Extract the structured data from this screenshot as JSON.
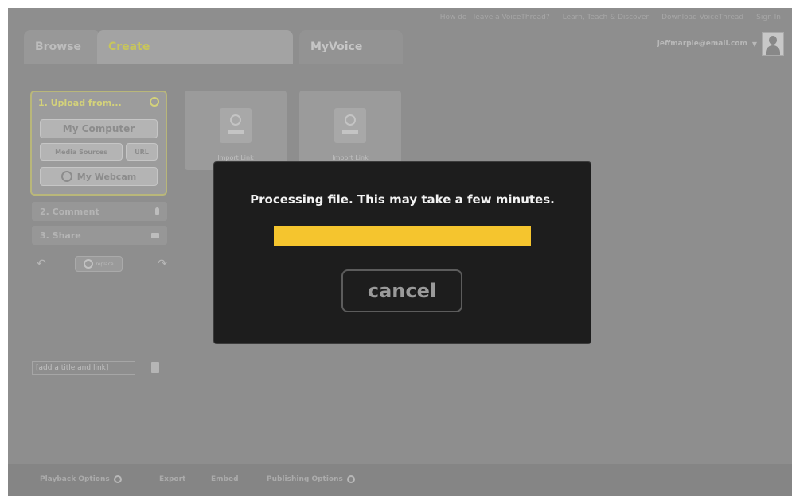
{
  "top_links": [
    "How do I leave a VoiceThread?",
    "Learn, Teach & Discover",
    "Download VoiceThread",
    "Sign In"
  ],
  "tabs": {
    "browse": "Browse",
    "create": "Create",
    "myvoice": "MyVoice"
  },
  "account": {
    "email": "jeffmarple@email.com",
    "caret": "▼"
  },
  "upload": {
    "title": "1. Upload from...",
    "my_computer": "My Computer",
    "media_sources": "Media Sources",
    "url": "URL",
    "my_webcam": "My Webcam"
  },
  "steps": {
    "comment": "2. Comment",
    "share": "3. Share"
  },
  "replace_label": "replace",
  "title_field": "[add a title and link]",
  "slots": [
    "Import Link",
    "Import Link"
  ],
  "bottom_bar": {
    "playback_options": "Playback Options",
    "export": "Export",
    "embed": "Embed",
    "publishing_options": "Publishing Options"
  },
  "modal": {
    "message": "Processing file. This may take a few minutes.",
    "progress": 1.0,
    "cancel": "cancel",
    "progress_color": "#f5c52e"
  },
  "icons": {
    "upload_add": "plus-circle-icon",
    "comment": "microphone-icon",
    "share": "envelope-icon",
    "undo": "undo-arrow-icon",
    "redo": "redo-arrow-icon",
    "webcam": "camera-icon",
    "trash": "trash-icon",
    "settings": "gear-icon"
  }
}
